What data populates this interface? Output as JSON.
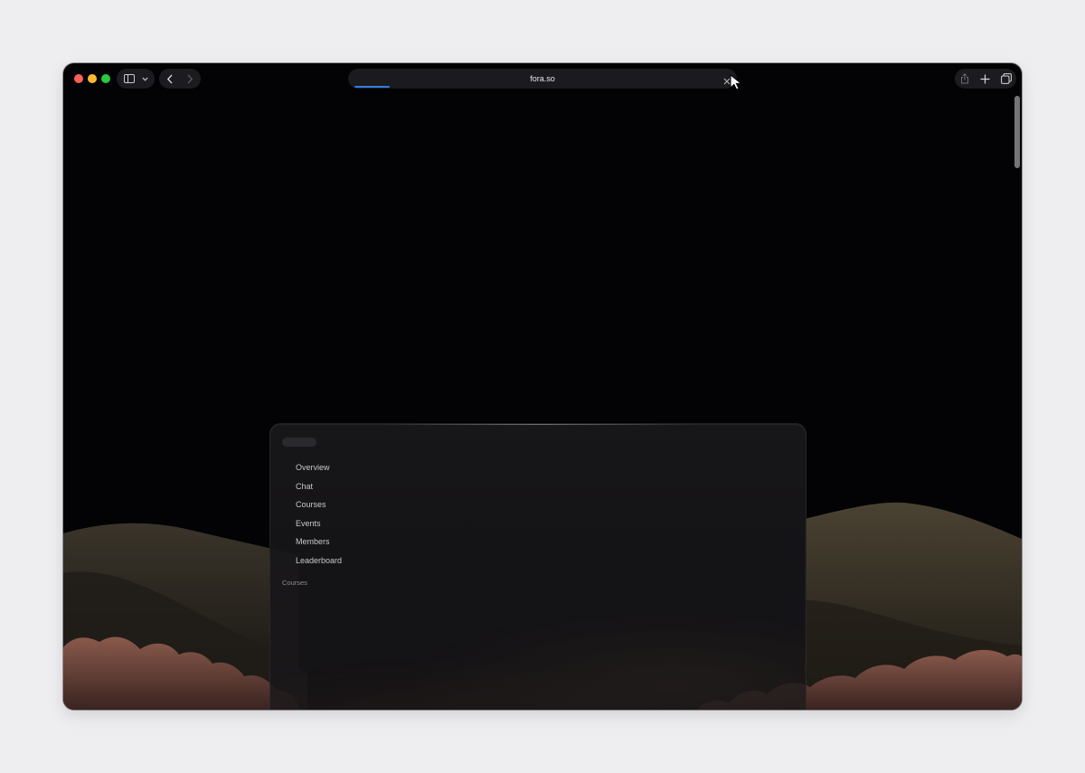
{
  "browser": {
    "url": "fora.so",
    "load_progress": 0.09
  },
  "app_preview": {
    "nav_items": [
      "Overview",
      "Chat",
      "Courses",
      "Events",
      "Members",
      "Leaderboard"
    ],
    "section_label": "Courses"
  },
  "colors": {
    "page_background": "#eeedf0",
    "window_background": "#030204",
    "accent_progress": "#2f7de1",
    "traffic_red": "#fe5f57",
    "traffic_yellow": "#febc2e",
    "traffic_green": "#28c840"
  },
  "icons": {
    "sidebar_toggle": "sidebar-icon",
    "sidebar_menu": "chevron-down-icon",
    "back": "chevron-left-icon",
    "forward": "chevron-right-icon",
    "stop": "close-icon",
    "share": "share-icon",
    "new_tab": "plus-icon",
    "tab_overview": "tabs-overview-icon"
  }
}
